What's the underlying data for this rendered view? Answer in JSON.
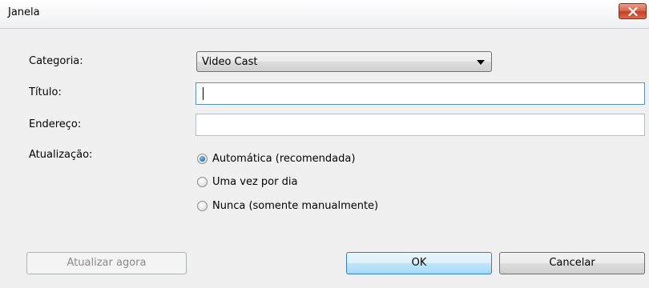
{
  "window": {
    "title": "Janela"
  },
  "form": {
    "categoria_label": "Categoria:",
    "categoria_value": "Video Cast",
    "titulo_label": "Título:",
    "titulo_value": "",
    "endereco_label": "Endereço:",
    "endereco_value": "",
    "atualizacao_label": "Atualização:",
    "atualizacao_options": [
      {
        "label": "Automática (recomendada)",
        "selected": true
      },
      {
        "label": "Uma vez por dia",
        "selected": false
      },
      {
        "label": "Nunca (somente manualmente)",
        "selected": false
      }
    ]
  },
  "buttons": {
    "atualizar_label": "Atualizar agora",
    "ok_label": "OK",
    "cancelar_label": "Cancelar"
  },
  "icons": {
    "close": "close-icon",
    "dropdown": "chevron-down-icon"
  },
  "colors": {
    "close_button": "#c24128",
    "default_button_border": "#3c7fb1",
    "radio_selected": "#1f6fb8"
  }
}
